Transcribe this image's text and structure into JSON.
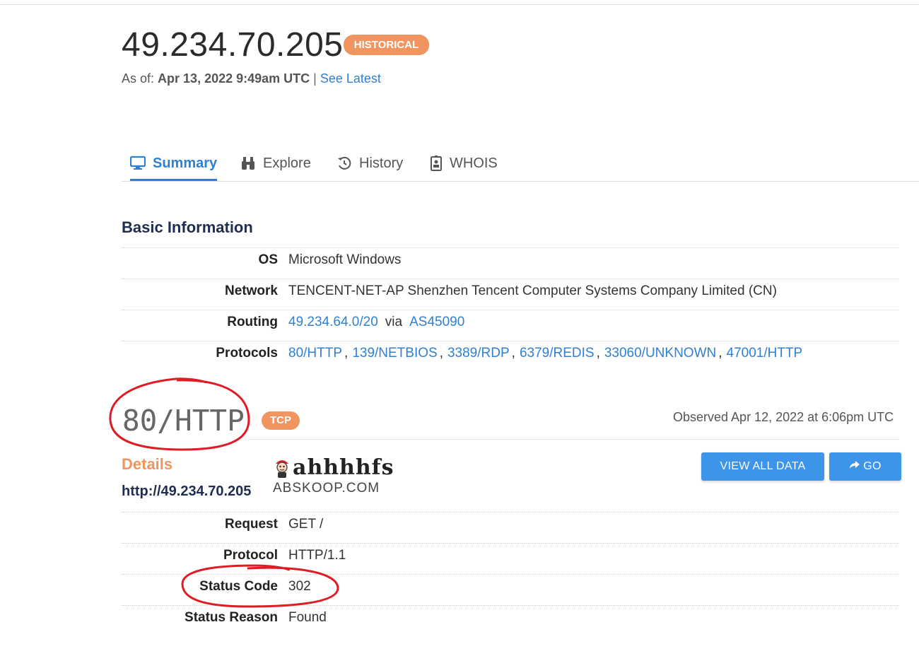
{
  "header": {
    "ip": "49.234.70.205",
    "badge": "HISTORICAL",
    "asof_prefix": "As of:",
    "asof_date": "Apr 13, 2022 9:49am UTC",
    "separator": "|",
    "see_latest": "See Latest"
  },
  "tabs": [
    {
      "label": "Summary",
      "icon": "monitor-icon",
      "active": true
    },
    {
      "label": "Explore",
      "icon": "binoculars-icon",
      "active": false
    },
    {
      "label": "History",
      "icon": "history-icon",
      "active": false
    },
    {
      "label": "WHOIS",
      "icon": "id-card-icon",
      "active": false
    }
  ],
  "basic": {
    "title": "Basic Information",
    "os_label": "OS",
    "os_value": "Microsoft Windows",
    "network_label": "Network",
    "network_value": "TENCENT-NET-AP Shenzhen Tencent Computer Systems Company Limited (CN)",
    "routing_label": "Routing",
    "routing_prefix": "49.234.64.0/20",
    "routing_via": "via",
    "routing_as": "AS45090",
    "protocols_label": "Protocols",
    "protocols": [
      "80/HTTP",
      "139/NETBIOS",
      "3389/RDP",
      "6379/REDIS",
      "33060/UNKNOWN",
      "47001/HTTP"
    ]
  },
  "service": {
    "port": "80/HTTP",
    "transport": "TCP",
    "observed": "Observed Apr 12, 2022 at 6:06pm UTC",
    "details_title": "Details",
    "url": "http://49.234.70.205",
    "view_all": "VIEW ALL DATA",
    "go": "GO",
    "request_label": "Request",
    "request_value": "GET /",
    "protocol_label": "Protocol",
    "protocol_value": "HTTP/1.1",
    "status_code_label": "Status Code",
    "status_code_value": "302",
    "status_reason_label": "Status Reason",
    "status_reason_value": "Found"
  },
  "watermark": {
    "text": "ahhhhfs",
    "sub": "ABSKOOP.COM"
  },
  "colors": {
    "accent": "#2f7fd4",
    "badge": "#f0955f",
    "button": "#3d94e8",
    "annotation": "#e01b24"
  }
}
